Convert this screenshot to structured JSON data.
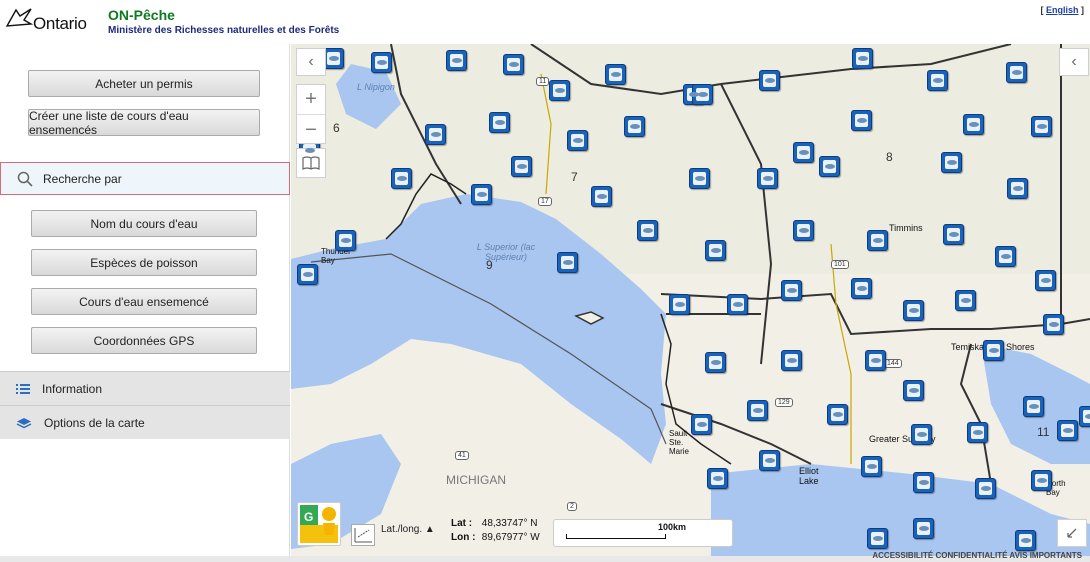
{
  "header": {
    "logo_text": "Ontario",
    "app_title": "ON-Pêche",
    "app_subtitle": "Ministère des Richesses naturelles et des Forêts",
    "language_link": "English",
    "lang_open": "[",
    "lang_close": "]"
  },
  "sidebar": {
    "buy_permit": "Acheter un permis",
    "create_list": "Créer une liste de cours d'eau ensemencés",
    "search_by": "Recherche par",
    "search_options": [
      "Nom du cours d'eau",
      "Espèces de poisson",
      "Cours d'eau ensemencé",
      "Coordonnées GPS"
    ],
    "information": "Information",
    "map_options": "Options de la carte"
  },
  "map": {
    "zoom_in": "+",
    "zoom_out": "−",
    "labels": {
      "nipigon": "L Nipigon",
      "superior": "L Superior (lac Supérieur)",
      "michigan": "MICHIGAN",
      "timmins": "Timmins",
      "temiskaming": "Temiskaming Shores",
      "greater_sudbury": "Greater Sudbury",
      "elliot_lake": "Elliot Lake",
      "thunder_bay": "Thunder Bay",
      "sault": "Sault Ste. Marie",
      "north_bay": "North Bay"
    },
    "regions": [
      "6",
      "7",
      "8",
      "9",
      "11"
    ],
    "roads": [
      "11",
      "17",
      "101",
      "144",
      "129",
      "41",
      "2"
    ],
    "icon_marker": "fish-stocking-icon",
    "coord_system": "Lat./long. ▲",
    "lat_label": "Lat :",
    "lat_value": "48,33747° N",
    "lon_label": "Lon :",
    "lon_value": "89,67977° W",
    "scale_label": "100km"
  },
  "footer": {
    "links": "ACCESSIBILITÉ   CONFIDENTIALITÉ   AVIS IMPORTANTS"
  },
  "colors": {
    "title_green": "#0d7b1f",
    "subtitle_navy": "#1d2a7a",
    "water": "#a8c6f0",
    "land": "#f2efe7",
    "marker_blue": "#1b63b8"
  }
}
